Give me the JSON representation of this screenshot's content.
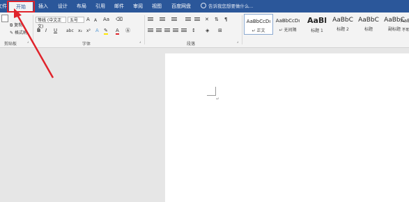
{
  "tabs": [
    {
      "label": "文件",
      "active": false
    },
    {
      "label": "开始",
      "active": true
    },
    {
      "label": "插入",
      "active": false
    },
    {
      "label": "设计",
      "active": false
    },
    {
      "label": "布局",
      "active": false
    },
    {
      "label": "引用",
      "active": false
    },
    {
      "label": "邮件",
      "active": false
    },
    {
      "label": "审阅",
      "active": false
    },
    {
      "label": "视图",
      "active": false
    },
    {
      "label": "百度网盘",
      "active": false
    }
  ],
  "tell_me": "告诉我您想要做什么...",
  "clipboard": {
    "copy": "复制",
    "format_painter": "格式刷",
    "group_label": "剪贴板"
  },
  "font": {
    "family": "等线 (中文正文)",
    "size": "五号",
    "group_label": "字体",
    "grow": "A",
    "shrink": "A",
    "case": "Aa",
    "bold": "B",
    "italic": "I",
    "underline": "U",
    "color_letter": "A"
  },
  "paragraph": {
    "group_label": "段落"
  },
  "styles": [
    {
      "sample": "AaBbCcDı",
      "name": "↵ 正文"
    },
    {
      "sample": "AaBbCcDı",
      "name": "↵ 无间隔"
    },
    {
      "sample": "AaBl",
      "name": "标题 1"
    },
    {
      "sample": "AaBbC",
      "name": "标题 2"
    },
    {
      "sample": "AaBbC",
      "name": "标题"
    },
    {
      "sample": "AaBbC",
      "name": "副标题"
    },
    {
      "sample": "AaBbCcDı",
      "name": "不明"
    }
  ],
  "document": {
    "paragraph_mark": "↵"
  },
  "colors": {
    "ribbon_blue": "#2b579a",
    "annotation_red": "#e0232b"
  }
}
